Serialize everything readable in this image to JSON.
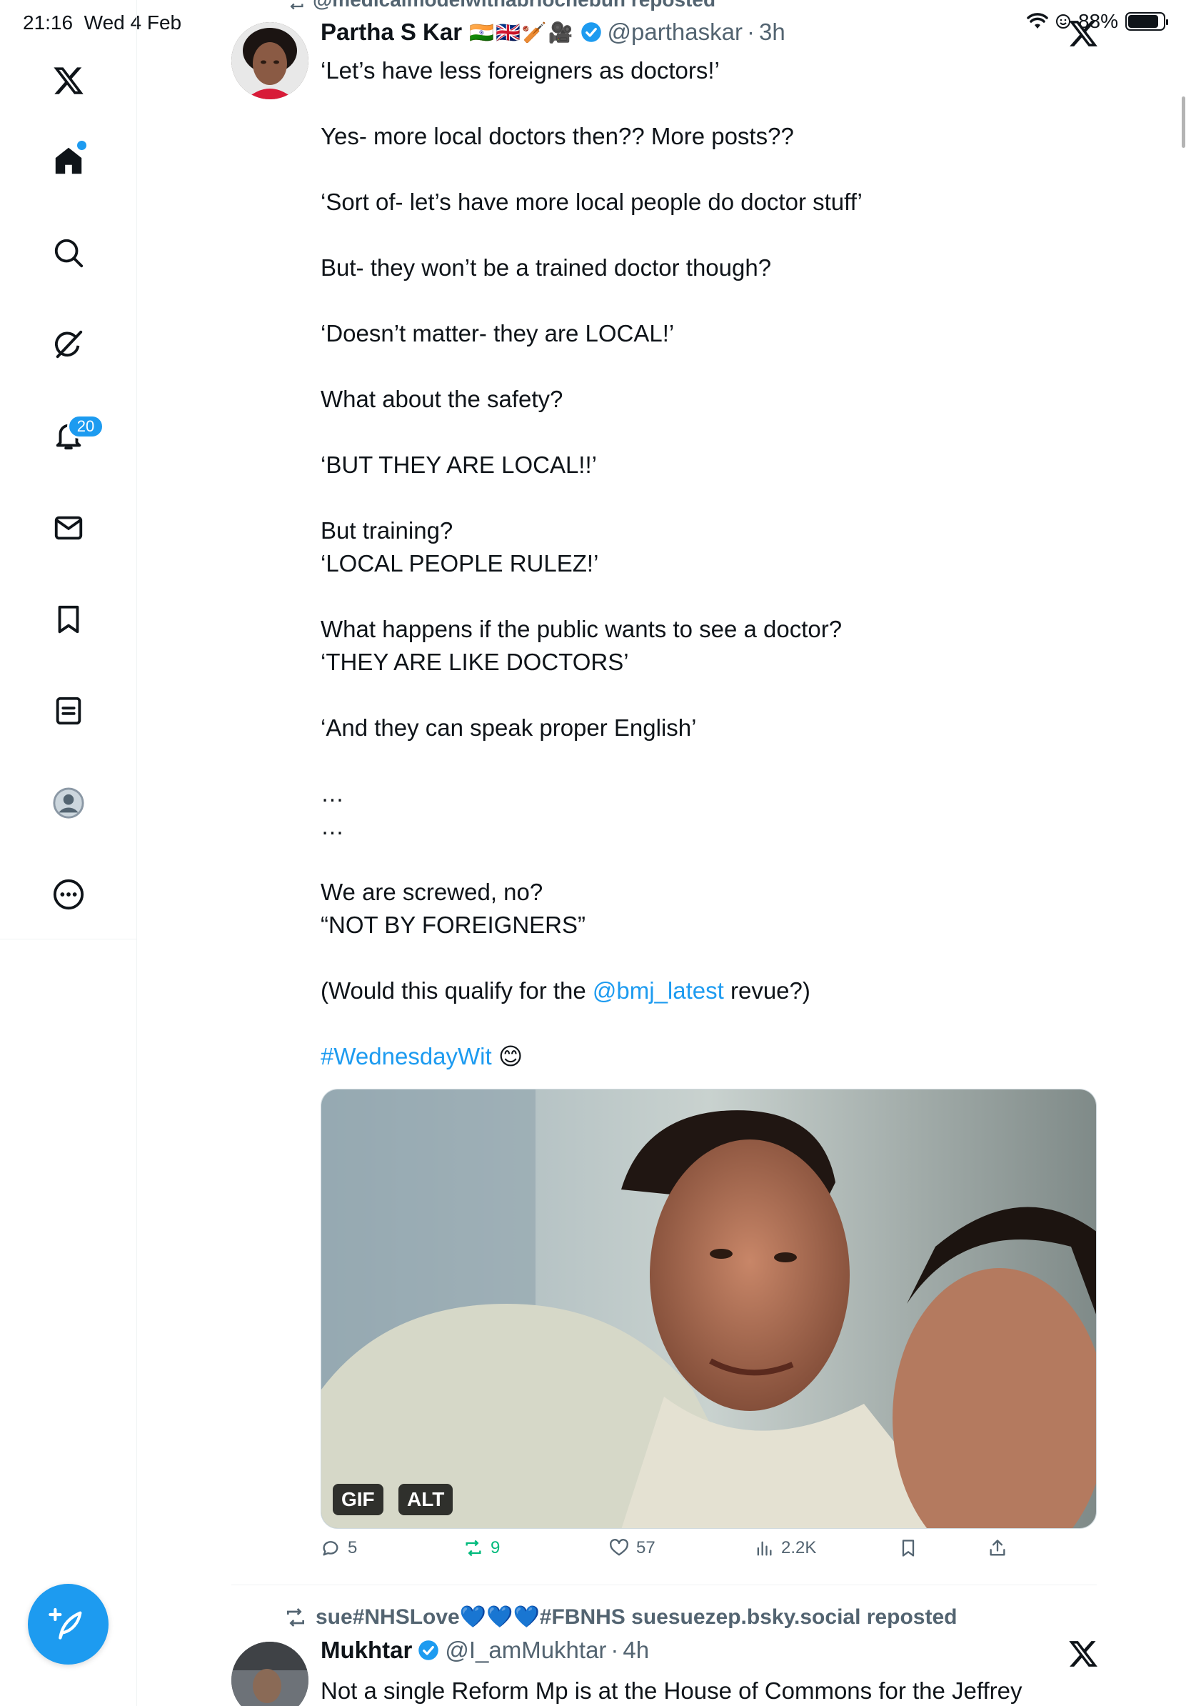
{
  "status_bar": {
    "time": "21:16",
    "date": "Wed 4 Feb",
    "battery": "88%"
  },
  "sidebar": {
    "items": [
      {
        "name": "x-logo-icon"
      },
      {
        "name": "home-icon"
      },
      {
        "name": "search-icon"
      },
      {
        "name": "grok-icon"
      },
      {
        "name": "notifications-icon",
        "badge": "20"
      },
      {
        "name": "messages-icon"
      },
      {
        "name": "bookmarks-icon"
      },
      {
        "name": "lists-icon"
      },
      {
        "name": "profile-icon"
      },
      {
        "name": "more-icon"
      }
    ],
    "compose": {
      "icon": "compose-icon"
    }
  },
  "tweet1": {
    "reposted_by": "@medicalmodelwithabriochebun reposted",
    "author_name": "Partha S Kar",
    "author_emoji": "🇮🇳🇬🇧🏏🎥",
    "handle": "@parthaskar",
    "dot": "·",
    "time": "3h",
    "lines": [
      "‘Let’s have less foreigners as doctors!’",
      "",
      "Yes- more local doctors then?? More posts??",
      "",
      "‘Sort of- let’s have more local people do doctor stuff’",
      "",
      "But- they won’t be a trained doctor though?",
      "",
      "‘Doesn’t matter- they are LOCAL!’",
      "",
      "What about the safety?",
      "",
      "‘BUT THEY ARE LOCAL!!’",
      "",
      "But training?",
      "‘LOCAL PEOPLE RULEZ!’",
      "",
      "What happens if the public wants to see a doctor?",
      "‘THEY ARE LIKE DOCTORS’",
      "",
      "‘And they can speak proper English’",
      "",
      "…",
      "…",
      "",
      "We are screwed, no?",
      "“NOT BY FOREIGNERS”",
      ""
    ],
    "mention_prefix": "(Would this qualify for the ",
    "mention": "@bmj_latest",
    "mention_suffix": " revue?)",
    "hashtag": "#WednesdayWit",
    "hashtag_emoji": "😊",
    "media": {
      "gif_label": "GIF",
      "alt_label": "ALT"
    },
    "actions": {
      "replies": "5",
      "reposts": "9",
      "likes": "57",
      "views": "2.2K"
    }
  },
  "tweet2": {
    "reposted_by": "sue#NHSLove💙💙💙#FBNHS suesuezep.bsky.social reposted",
    "author_name": "Mukhtar",
    "handle": "@I_amMukhtar",
    "dot": "·",
    "time": "4h",
    "text": "Not a single Reform Mp is at the House of Commons for the Jeffrey"
  },
  "colors": {
    "accent": "#1d9bf0",
    "repost_green": "#00ba7c",
    "secondary_text": "#536471"
  }
}
